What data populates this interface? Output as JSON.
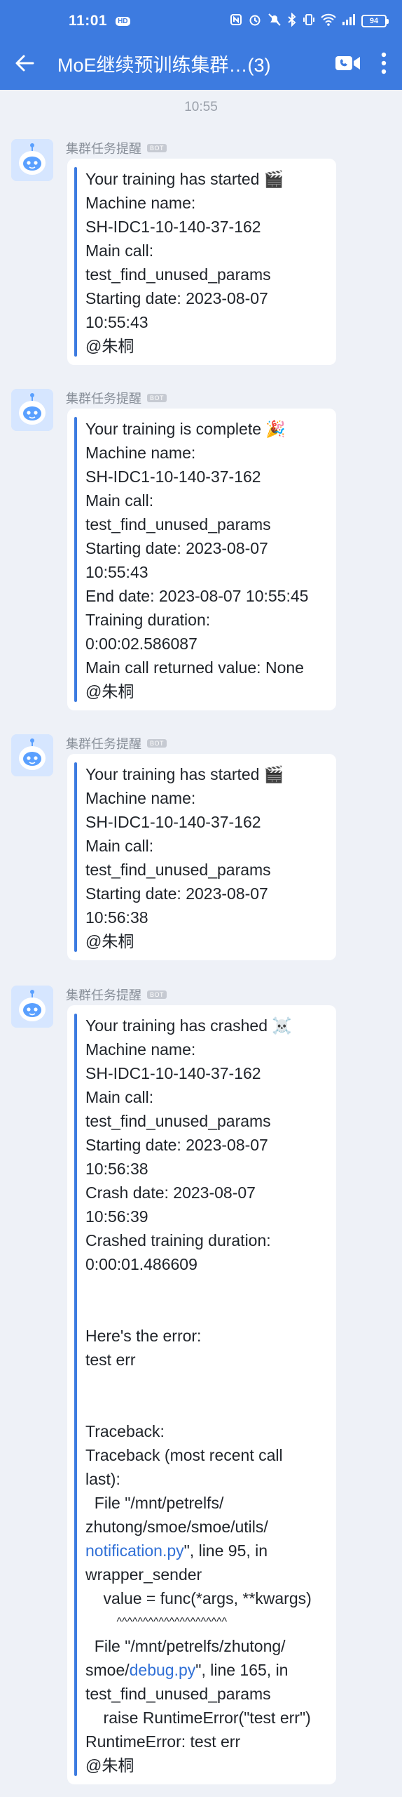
{
  "status_bar": {
    "time": "11:01",
    "hd": "HD",
    "battery": "94"
  },
  "header": {
    "title": "MoE继续预训练集群…(3)"
  },
  "chat": {
    "timestamp": "10:55",
    "messages": [
      {
        "sender": "集群任务提醒",
        "tag": "BOT",
        "lines": [
          "Your training has started 🎬",
          "Machine name:",
          "SH-IDC1-10-140-37-162",
          "Main call:",
          "test_find_unused_params",
          "Starting date: 2023-08-07",
          "10:55:43",
          "@朱桐"
        ]
      },
      {
        "sender": "集群任务提醒",
        "tag": "BOT",
        "lines": [
          "Your training is complete 🎉",
          "Machine name:",
          "SH-IDC1-10-140-37-162",
          "Main call:",
          "test_find_unused_params",
          "Starting date: 2023-08-07",
          "10:55:43",
          "End date: 2023-08-07 10:55:45",
          "Training duration:",
          "0:00:02.586087",
          "Main call returned value: None",
          "@朱桐"
        ]
      },
      {
        "sender": "集群任务提醒",
        "tag": "BOT",
        "lines": [
          "Your training has started 🎬",
          "Machine name:",
          "SH-IDC1-10-140-37-162",
          "Main call:",
          "test_find_unused_params",
          "Starting date: 2023-08-07",
          "10:56:38",
          "@朱桐"
        ]
      },
      {
        "sender": "集群任务提醒",
        "tag": "BOT",
        "lines": [
          "Your training has crashed ☠️",
          "Machine name:",
          "SH-IDC1-10-140-37-162",
          "Main call:",
          "test_find_unused_params",
          "Starting date: 2023-08-07",
          "10:56:38",
          "Crash date: 2023-08-07",
          "10:56:39",
          "Crashed training duration:",
          "0:00:01.486609",
          "",
          "",
          "Here's the error:",
          "test err",
          "",
          "",
          "Traceback:",
          "Traceback (most recent call",
          "last):",
          "  File \"/mnt/petrelfs/",
          "zhutong/smoe/smoe/utils/",
          "notification.py|\", line 95, in",
          "wrapper_sender",
          "    value = func(*args, **kwargs)",
          "          ^^^^^^^^^^^^^^^^^^^^^",
          "  File \"/mnt/petrelfs/zhutong/",
          "smoe/debug.py|\", line 165, in",
          "test_find_unused_params",
          "    raise RuntimeError(\"test err\")",
          "RuntimeError: test err",
          "@朱桐"
        ]
      }
    ]
  }
}
